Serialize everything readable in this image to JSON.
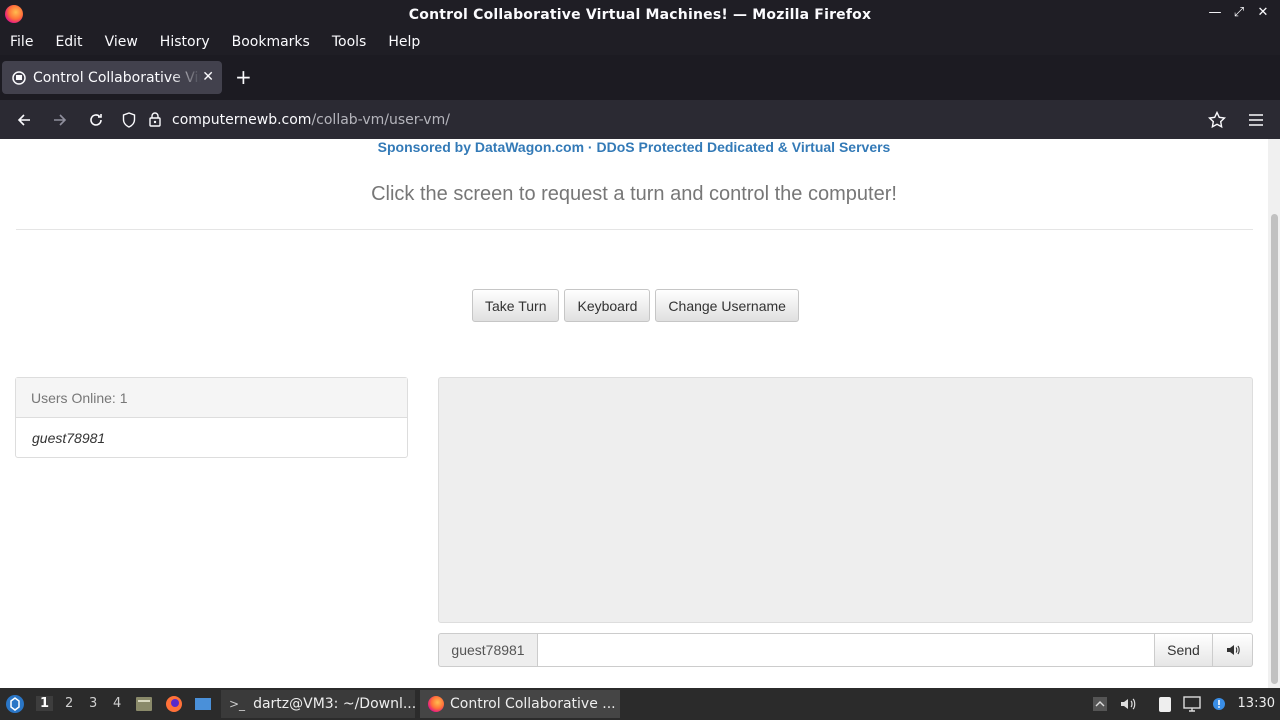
{
  "window": {
    "title": "Control Collaborative Virtual Machines! — Mozilla Firefox",
    "controls": [
      "minimize-icon",
      "maximize-icon",
      "close-icon"
    ]
  },
  "menubar": {
    "items": [
      {
        "label": "File"
      },
      {
        "label": "Edit"
      },
      {
        "label": "View"
      },
      {
        "label": "History"
      },
      {
        "label": "Bookmarks"
      },
      {
        "label": "Tools"
      },
      {
        "label": "Help"
      }
    ]
  },
  "tabs": {
    "active": {
      "label": "Control Collaborative Virtual Machines!",
      "favicon": "computer-favicon"
    },
    "new_tab_icon": "plus-icon"
  },
  "navbar": {
    "url_host": "computernewb.com",
    "url_path": "/collab-vm/user-vm/"
  },
  "page": {
    "sponsor_left": "Sponsored by DataWagon.com",
    "sponsor_sep": " · ",
    "sponsor_right": "DDoS Protected Dedicated & Virtual Servers",
    "headline": "Click the screen to request a turn and control the computer!",
    "buttons": {
      "take_turn": "Take Turn",
      "keyboard": "Keyboard",
      "change_username": "Change Username"
    },
    "users": {
      "heading": "Users Online: 1",
      "list": [
        "guest78981"
      ]
    },
    "chat": {
      "username": "guest78981",
      "input_value": "",
      "send": "Send",
      "volume_icon": "volume-icon"
    }
  },
  "taskbar": {
    "workspaces": [
      "1",
      "2",
      "3",
      "4"
    ],
    "active_workspace": "1",
    "tasks": [
      {
        "label": "dartz@VM3: ~/Downl..."
      },
      {
        "label": "Control Collaborative ..."
      }
    ],
    "clock": "13:30"
  },
  "colors": {
    "link": "#337ab7",
    "chrome_dark": "#1f1e25",
    "navbar": "#2b2a33"
  }
}
